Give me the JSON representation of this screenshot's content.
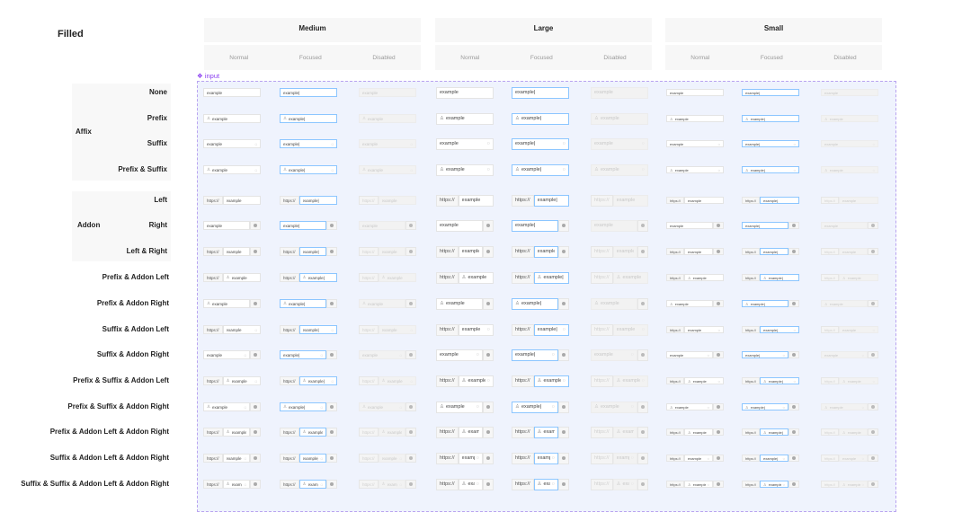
{
  "title": "Filled",
  "component_label": "input",
  "sizes": [
    {
      "label": "Medium",
      "key": "medium"
    },
    {
      "label": "Large",
      "key": "large"
    },
    {
      "label": "Small",
      "key": "small"
    }
  ],
  "states": [
    "Normal",
    "Focused",
    "Disabled"
  ],
  "groups": [
    {
      "label": "Affix"
    },
    {
      "label": "Addon"
    }
  ],
  "field_text": "example",
  "addon_text": "https://",
  "prefix_icon": "user-icon",
  "suffix_icon": "clear-circle-icon",
  "addon_right_icon": "gear-icon",
  "rows": [
    {
      "label": "None",
      "group": 0,
      "addonLeft": false,
      "prefix": false,
      "suffix": false,
      "addonRight": false
    },
    {
      "label": "Prefix",
      "group": 0,
      "addonLeft": false,
      "prefix": true,
      "suffix": false,
      "addonRight": false
    },
    {
      "label": "Suffix",
      "group": 0,
      "addonLeft": false,
      "prefix": false,
      "suffix": true,
      "addonRight": false
    },
    {
      "label": "Prefix & Suffix",
      "group": 0,
      "addonLeft": false,
      "prefix": true,
      "suffix": true,
      "addonRight": false
    },
    {
      "label": "Left",
      "group": 1,
      "addonLeft": true,
      "prefix": false,
      "suffix": false,
      "addonRight": false
    },
    {
      "label": "Right",
      "group": 1,
      "addonLeft": false,
      "prefix": false,
      "suffix": false,
      "addonRight": true
    },
    {
      "label": "Left & Right",
      "group": 1,
      "addonLeft": true,
      "prefix": false,
      "suffix": false,
      "addonRight": true
    },
    {
      "label": "Prefix & Addon Left",
      "addonLeft": true,
      "prefix": true,
      "suffix": false,
      "addonRight": false
    },
    {
      "label": "Prefix & Addon Right",
      "addonLeft": false,
      "prefix": true,
      "suffix": false,
      "addonRight": true
    },
    {
      "label": "Suffix & Addon Left",
      "addonLeft": true,
      "prefix": false,
      "suffix": true,
      "addonRight": false
    },
    {
      "label": "Suffix & Addon Right",
      "addonLeft": false,
      "prefix": false,
      "suffix": true,
      "addonRight": true
    },
    {
      "label": "Prefix & Suffix & Addon Left",
      "addonLeft": true,
      "prefix": true,
      "suffix": true,
      "addonRight": false
    },
    {
      "label": "Prefix & Suffix & Addon Right",
      "addonLeft": false,
      "prefix": true,
      "suffix": true,
      "addonRight": true
    },
    {
      "label": "Prefix & Addon Left & Addon Right",
      "addonLeft": true,
      "prefix": true,
      "suffix": false,
      "addonRight": true
    },
    {
      "label": "Suffix & Addon Left & Addon Right",
      "addonLeft": true,
      "prefix": false,
      "suffix": true,
      "addonRight": true
    },
    {
      "label": "Suffix & Suffix & Addon Left & Addon Right",
      "addonLeft": true,
      "prefix": true,
      "suffix": true,
      "addonRight": true
    }
  ]
}
